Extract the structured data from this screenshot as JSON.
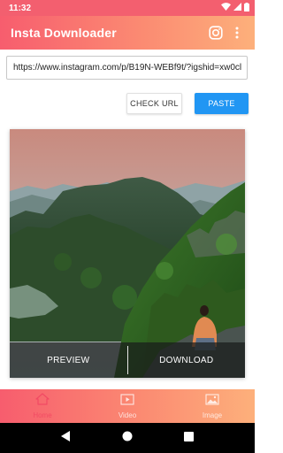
{
  "status_bar": {
    "time": "11:32"
  },
  "app_bar": {
    "title": "Insta Downloader",
    "icons": [
      "instagram-icon",
      "more-vert-icon"
    ]
  },
  "url_input": {
    "value": "https://www.instagram.com/p/B19N-WEBf9t/?igshid=xw0cl"
  },
  "buttons": {
    "check_url": "CHECK URL",
    "paste": "PASTE"
  },
  "media_card": {
    "preview_label": "PREVIEW",
    "download_label": "DOWNLOAD"
  },
  "bottom_nav": {
    "items": [
      {
        "label": "Home",
        "icon": "home-icon",
        "active": true
      },
      {
        "label": "Video",
        "icon": "video-icon",
        "active": false
      },
      {
        "label": "Image",
        "icon": "image-icon",
        "active": false
      }
    ]
  },
  "colors": {
    "accent_start": "#f75d6e",
    "accent_end": "#fdb07b",
    "primary_button": "#2196f3",
    "active_tab": "#f24a63"
  }
}
